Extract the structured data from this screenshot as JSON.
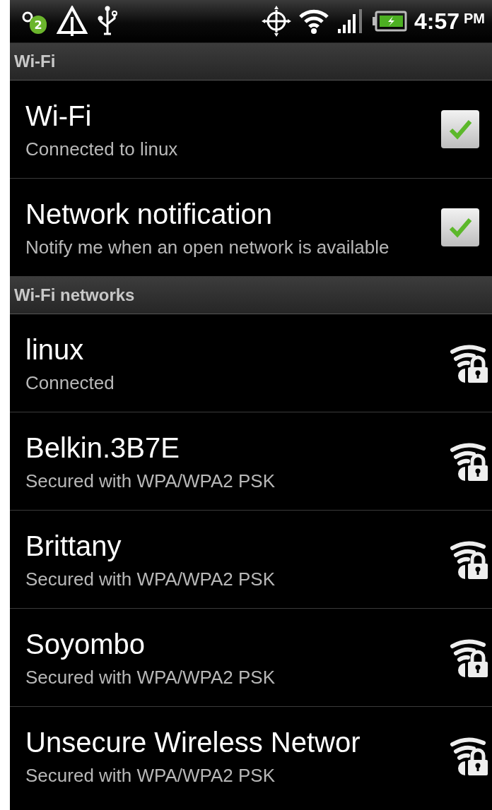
{
  "status_bar": {
    "notification_count": "2",
    "time": "4:57",
    "period": "PM"
  },
  "sections": [
    {
      "header": "Wi-Fi",
      "items": [
        {
          "kind": "checkbox",
          "title": "Wi-Fi",
          "summary": "Connected to linux",
          "checked": true
        },
        {
          "kind": "checkbox",
          "title": "Network notification",
          "summary": "Notify me when an open network is available",
          "checked": true
        }
      ]
    },
    {
      "header": "Wi-Fi networks",
      "items": [
        {
          "kind": "network",
          "title": "linux",
          "summary": "Connected",
          "secured": true
        },
        {
          "kind": "network",
          "title": "Belkin.3B7E",
          "summary": "Secured with WPA/WPA2 PSK",
          "secured": true
        },
        {
          "kind": "network",
          "title": "Brittany",
          "summary": "Secured with WPA/WPA2 PSK",
          "secured": true
        },
        {
          "kind": "network",
          "title": "Soyombo",
          "summary": "Secured with WPA/WPA2 PSK",
          "secured": true
        },
        {
          "kind": "network",
          "title": "Unsecure Wireless Networ",
          "summary": "Secured with WPA/WPA2 PSK",
          "secured": true
        }
      ]
    }
  ]
}
